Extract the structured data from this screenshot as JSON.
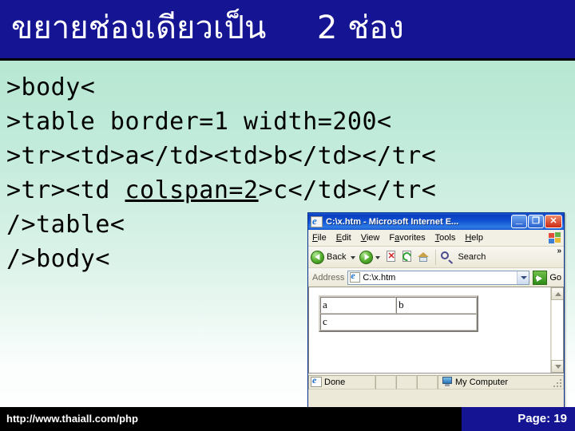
{
  "slide": {
    "title": "ขยายช่องเดียวเป็น     2 ช่อง",
    "background_top_color": "#b0e5ca",
    "background_bottom_color": "#ffffff",
    "title_bar_color": "#151593"
  },
  "code": {
    "lines": [
      {
        "text": ">body<",
        "underline": ""
      },
      {
        "text": ">table border=1 width=200<",
        "underline": ""
      },
      {
        "text": ">tr><td>a</td><td>b</td></tr<",
        "underline": ""
      },
      {
        "pre": ">tr><td ",
        "underline": "colspan=2",
        "post": ">c</td></tr<"
      },
      {
        "text": "/>table<",
        "underline": ""
      },
      {
        "text": "/>body<",
        "underline": ""
      }
    ]
  },
  "browser": {
    "title": "C:\\x.htm - Microsoft Internet E...",
    "window_buttons": {
      "minimize": "_",
      "maximize": "❐",
      "close": "✕"
    },
    "menu": [
      {
        "label": "File",
        "accel": "F"
      },
      {
        "label": "Edit",
        "accel": "E"
      },
      {
        "label": "View",
        "accel": "V"
      },
      {
        "label": "Favorites",
        "accel": "a"
      },
      {
        "label": "Tools",
        "accel": "T"
      },
      {
        "label": "Help",
        "accel": "H"
      }
    ],
    "toolbar": {
      "back_label": "Back",
      "search_label": "Search",
      "overflow_label": "»",
      "icons": [
        "back-arrow-icon",
        "back-dropdown-icon",
        "forward-arrow-icon",
        "forward-dropdown-icon",
        "stop-icon",
        "refresh-icon",
        "home-icon",
        "search-icon"
      ]
    },
    "address": {
      "label": "Address",
      "value": "C:\\x.htm",
      "go_label": "Go"
    },
    "page_table": {
      "rows": [
        {
          "cells": [
            {
              "text": "a",
              "colspan": 1
            },
            {
              "text": "b",
              "colspan": 1
            }
          ]
        },
        {
          "cells": [
            {
              "text": "c",
              "colspan": 2
            }
          ]
        }
      ],
      "border": "1",
      "width": "200"
    },
    "status": {
      "left": "Done",
      "zone": "My Computer"
    }
  },
  "footer": {
    "url": "http://www.thaiall.com/php",
    "page_label": "Page: 19",
    "bar_color": "#000000",
    "page_box_color": "#151593"
  }
}
